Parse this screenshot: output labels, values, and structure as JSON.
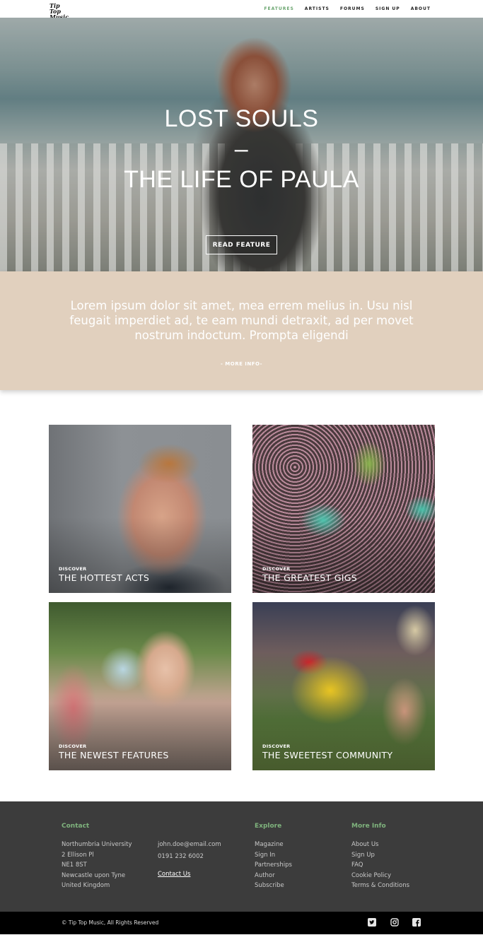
{
  "nav": {
    "logo": "Tip Top Music",
    "links": [
      "FEATURES",
      "ARTISTS",
      "FORUMS",
      "SIGN UP",
      "ABOUT"
    ],
    "active": "FEATURES"
  },
  "hero": {
    "title_line1": "LOST SOULS",
    "title_line2": "–",
    "title_line3": "THE LIFE OF PAULA",
    "button": "READ FEATURE"
  },
  "intro": {
    "text": "Lorem ipsum dolor sit amet, mea errem melius in. Usu nisl feugait imperdiet ad, te eam mundi detraxit, ad per movet nostrum indoctum. Prompta eligendi",
    "more": "- MORE INFO-"
  },
  "cards": [
    {
      "kicker": "DISCOVER",
      "title": "THE HOTTEST ACTS"
    },
    {
      "kicker": "DISCOVER",
      "title": "THE GREATEST GIGS"
    },
    {
      "kicker": "DISCOVER",
      "title": "THE NEWEST FEATURES"
    },
    {
      "kicker": "DISCOVER",
      "title": "THE SWEETEST COMMUNITY"
    }
  ],
  "footer": {
    "contact": {
      "heading": "Contact",
      "address": [
        "Northumbria University",
        "2 Ellison Pl",
        "NE1 8ST",
        "Newcastle upon Tyne",
        "United Kingdom"
      ],
      "email": "john.doe@email.com",
      "phone": "0191 232 6002",
      "link": "Contact Us"
    },
    "explore": {
      "heading": "Explore",
      "items": [
        "Magazine",
        "Sign In",
        "Partnerships",
        "Author",
        "Subscribe"
      ]
    },
    "more": {
      "heading": "More Info",
      "items": [
        "About Us",
        "Sign Up",
        "FAQ",
        "Cookie Policy",
        "Terms & Conditions"
      ]
    },
    "copyright": "© Tip Top Music, All Rights Reserved",
    "social_icons": [
      "twitter-icon",
      "instagram-icon",
      "facebook-icon"
    ]
  },
  "colors": {
    "accent_green": "#6aa56f",
    "intro_bg": "#e1d0be",
    "footer_bg": "#3c3c3c",
    "bottom_bg": "#000000"
  }
}
